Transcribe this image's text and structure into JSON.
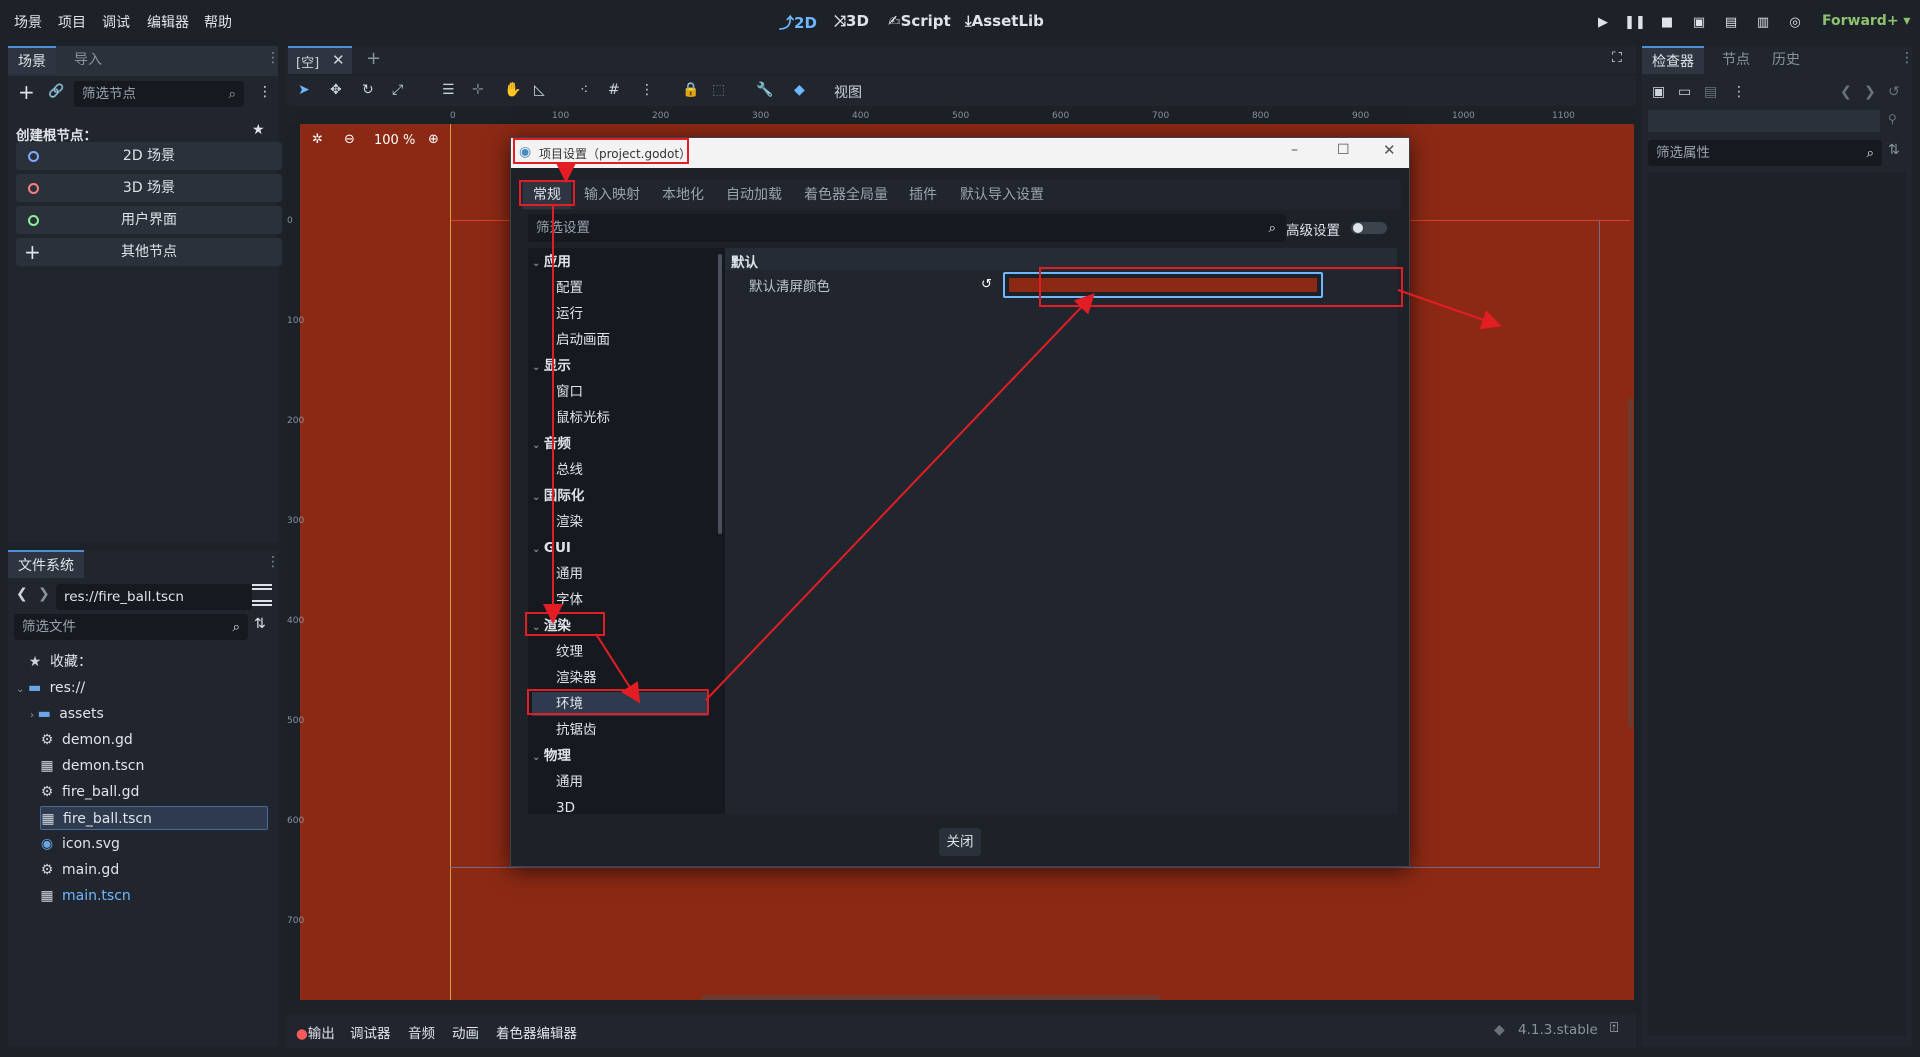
{
  "menu": [
    "场景",
    "项目",
    "调试",
    "编辑器",
    "帮助"
  ],
  "modes": [
    "2D",
    "3D",
    "Script",
    "AssetLib"
  ],
  "renderer": "Forward+",
  "scene_dock": {
    "tabs": [
      "场景",
      "导入"
    ],
    "filter_placeholder": "筛选节点",
    "create_root_label": "创建根节点：",
    "root_buttons": [
      "2D 场景",
      "3D 场景",
      "用户界面",
      "其他节点"
    ]
  },
  "filesystem_dock": {
    "title": "文件系统",
    "path": "res://fire_ball.tscn",
    "filter_placeholder": "筛选文件",
    "items": [
      "收藏：",
      "res://",
      "assets",
      "demon.gd",
      "demon.tscn",
      "fire_ball.gd",
      "fire_ball.tscn",
      "icon.svg",
      "main.gd",
      "main.tscn"
    ]
  },
  "editor": {
    "scene_tab": "[空]",
    "zoom": "100 %",
    "view_menu": "视图",
    "ruler_h": [
      "0",
      "100",
      "200",
      "300",
      "400",
      "500",
      "600",
      "700",
      "800",
      "900",
      "1000",
      "1100"
    ],
    "ruler_v": [
      "0",
      "100",
      "200",
      "300",
      "400",
      "500",
      "600",
      "700"
    ]
  },
  "dialog": {
    "title": "项目设置（project.godot）",
    "tabs": [
      "常规",
      "输入映射",
      "本地化",
      "自动加载",
      "着色器全局量",
      "插件",
      "默认导入设置"
    ],
    "filter_placeholder": "筛选设置",
    "advanced_label": "高级设置",
    "tree": [
      "应用",
      "配置",
      "运行",
      "启动画面",
      "显示",
      "窗口",
      "鼠标光标",
      "音频",
      "总线",
      "国际化",
      "渲染",
      "GUI",
      "通用",
      "字体",
      "渲染",
      "纹理",
      "渲染器",
      "环境",
      "抗锯齿",
      "物理",
      "通用",
      "3D"
    ],
    "section": "默认",
    "property_label": "默认清屏颜色",
    "property_color": "#8b2914",
    "close_button": "关闭"
  },
  "inspector": {
    "tabs": [
      "检查器",
      "节点",
      "历史"
    ],
    "filter_placeholder": "筛选属性"
  },
  "bottom_bar": {
    "tabs": [
      "输出",
      "调试器",
      "音频",
      "动画",
      "着色器编辑器"
    ],
    "version": "4.1.3.stable"
  },
  "colors": {
    "accent": "#4a90d9",
    "annotation": "#e21d24",
    "clear_color": "#8b2914"
  }
}
